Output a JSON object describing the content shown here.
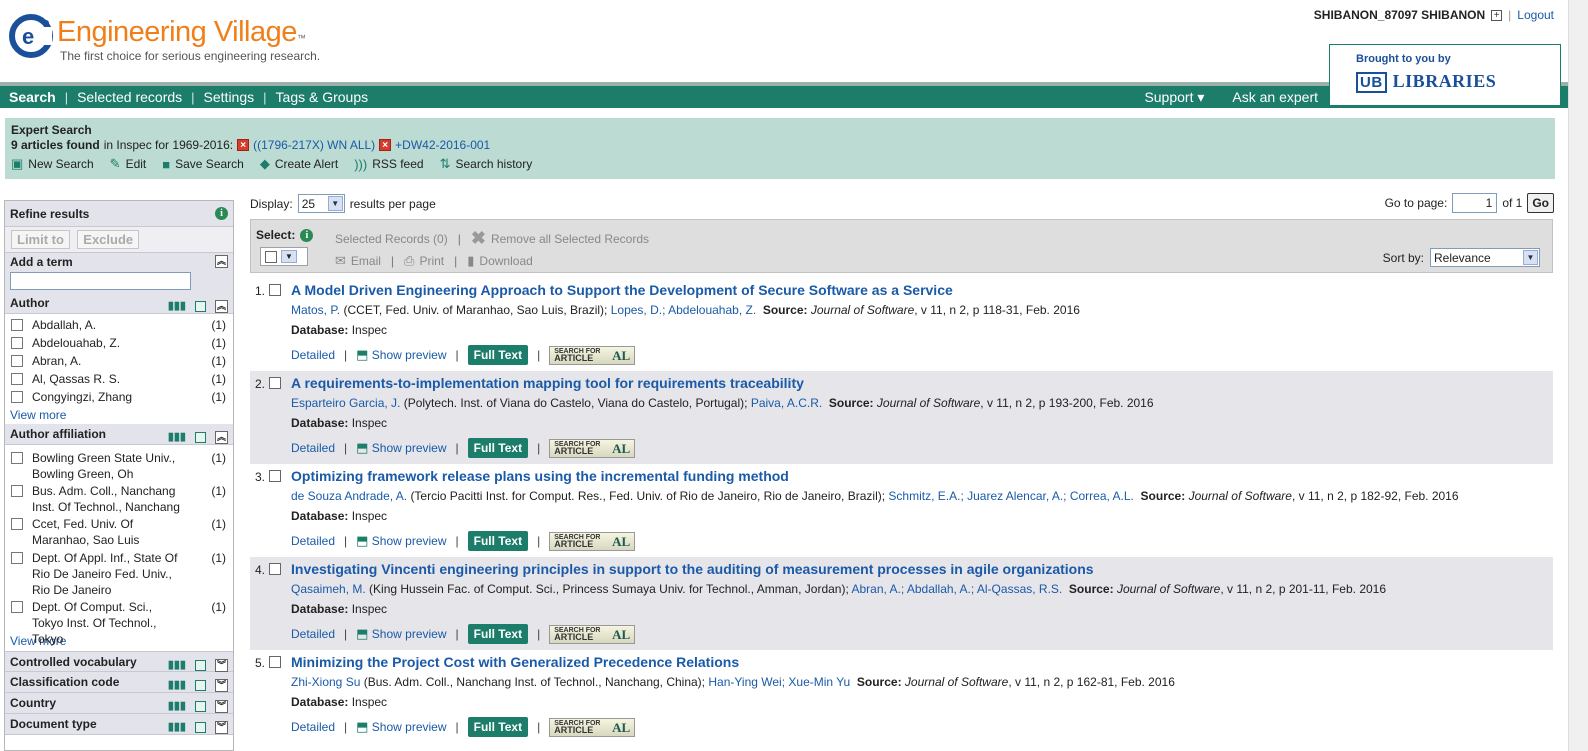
{
  "header": {
    "brand": "Engineering Village",
    "tm": "™",
    "tagline": "The first choice for serious engineering research.",
    "username": "SHIBANON_87097 SHIBANON",
    "plus": "⊞",
    "logout": "Logout",
    "library_caption": "Brought to you by",
    "library_mark": "UB",
    "library_name": "LIBRARIES"
  },
  "nav": {
    "items": [
      "Search",
      "Selected records",
      "Settings",
      "Tags & Groups"
    ],
    "support": "Support ▾",
    "ask": "Ask an expert"
  },
  "expert": {
    "title": "Expert Search",
    "count_bold": "9 articles found",
    "count_rest": "in Inspec for 1969-2016:",
    "term1": "((1796-217X) WN ALL)",
    "term2": "+DW42-2016-001",
    "actions": [
      "New Search",
      "Edit",
      "Save Search",
      "Create Alert",
      "RSS feed",
      "Search history"
    ]
  },
  "sidebar": {
    "refine_title": "Refine results",
    "limit_to": "Limit to",
    "exclude": "Exclude",
    "add_term": "Add a term",
    "author_title": "Author",
    "authors": [
      {
        "name": "Abdallah, A.",
        "count": "(1)"
      },
      {
        "name": "Abdelouahab, Z.",
        "count": "(1)"
      },
      {
        "name": "Abran, A.",
        "count": "(1)"
      },
      {
        "name": "Al, Qassas R. S.",
        "count": "(1)"
      },
      {
        "name": "Congyingzi, Zhang",
        "count": "(1)"
      }
    ],
    "view_more": "View more",
    "affil_title": "Author affiliation",
    "affiliations": [
      {
        "name": "Bowling Green State Univ., Bowling Green, Oh",
        "count": "(1)"
      },
      {
        "name": "Bus. Adm. Coll., Nanchang Inst. Of Technol., Nanchang",
        "count": "(1)"
      },
      {
        "name": "Ccet, Fed. Univ. Of Maranhao, Sao Luis",
        "count": "(1)"
      },
      {
        "name": "Dept. Of Appl. Inf., State Of Rio De Janeiro Fed. Univ., Rio De Janeiro",
        "count": "(1)"
      },
      {
        "name": "Dept. Of Comput. Sci., Tokyo Inst. Of Technol., Tokyo",
        "count": "(1)"
      }
    ],
    "collapsed": [
      "Controlled vocabulary",
      "Classification code",
      "Country",
      "Document type"
    ]
  },
  "results_header": {
    "display_label": "Display:",
    "per_page": "25",
    "per_page_suffix": "results per page",
    "goto_label": "Go to page:",
    "goto_value": "1",
    "of_pages": "of 1",
    "go": "Go",
    "select_label": "Select:",
    "selected_records": "Selected Records (0)",
    "remove_all": "Remove all Selected Records",
    "email": "Email",
    "print": "Print",
    "download": "Download",
    "sort_label": "Sort by:",
    "sort_value": "Relevance"
  },
  "actions": {
    "detailed": "Detailed",
    "show_preview": "Show preview",
    "full_text": "Full Text",
    "sfa_line1": "SEARCH FOR",
    "sfa_line2": "ARTICLE",
    "sfa_mark": "AL",
    "db_label": "Database:",
    "source_label": "Source:"
  },
  "results": [
    {
      "num": "1.",
      "title": "A Model Driven Engineering Approach to Support the Development of Secure Software as a Service",
      "author1": "Matos, P.",
      "affil": "(CCET, Fed. Univ. of Maranhao, Sao Luis, Brazil);",
      "others": "Lopes, D.; Abdelouahab, Z.",
      "journal": "Journal of Software",
      "details": ", v 11, n 2, p 118-31, Feb. 2016",
      "db": "Inspec"
    },
    {
      "num": "2.",
      "title": "A requirements-to-implementation mapping tool for requirements traceability",
      "author1": "Esparteiro Garcia, J.",
      "affil": "(Polytech. Inst. of Viana do Castelo, Viana do Castelo, Portugal);",
      "others": "Paiva, A.C.R.",
      "journal": "Journal of Software",
      "details": ", v 11, n 2, p 193-200, Feb. 2016",
      "db": "Inspec"
    },
    {
      "num": "3.",
      "title": "Optimizing framework release plans using the incremental funding method",
      "author1": "de Souza Andrade, A.",
      "affil": "(Tercio Pacitti Inst. for Comput. Res., Fed. Univ. of Rio de Janeiro, Rio de Janeiro, Brazil);",
      "others": "Schmitz, E.A.; Juarez Alencar, A.; Correa, A.L.",
      "journal": "Journal of Software",
      "details": ", v 11, n 2, p 182-92, Feb. 2016",
      "db": "Inspec"
    },
    {
      "num": "4.",
      "title": "Investigating Vincenti engineering principles in support to the auditing of measurement processes in agile organizations",
      "author1": "Qasaimeh, M.",
      "affil": "(King Hussein Fac. of Comput. Sci., Princess Sumaya Univ. for Technol., Amman, Jordan);",
      "others": "Abran, A.; Abdallah, A.; Al-Qassas, R.S.",
      "journal": "Journal of Software",
      "details": ", v 11, n 2, p 201-11, Feb. 2016",
      "db": "Inspec"
    },
    {
      "num": "5.",
      "title": "Minimizing the Project Cost with Generalized Precedence Relations",
      "author1": "Zhi-Xiong Su",
      "affil": "(Bus. Adm. Coll., Nanchang Inst. of Technol., Nanchang, China);",
      "others": "Han-Ying Wei; Xue-Min Yu",
      "journal": "Journal of Software",
      "details": ", v 11, n 2, p 162-81, Feb. 2016",
      "db": "Inspec"
    }
  ]
}
